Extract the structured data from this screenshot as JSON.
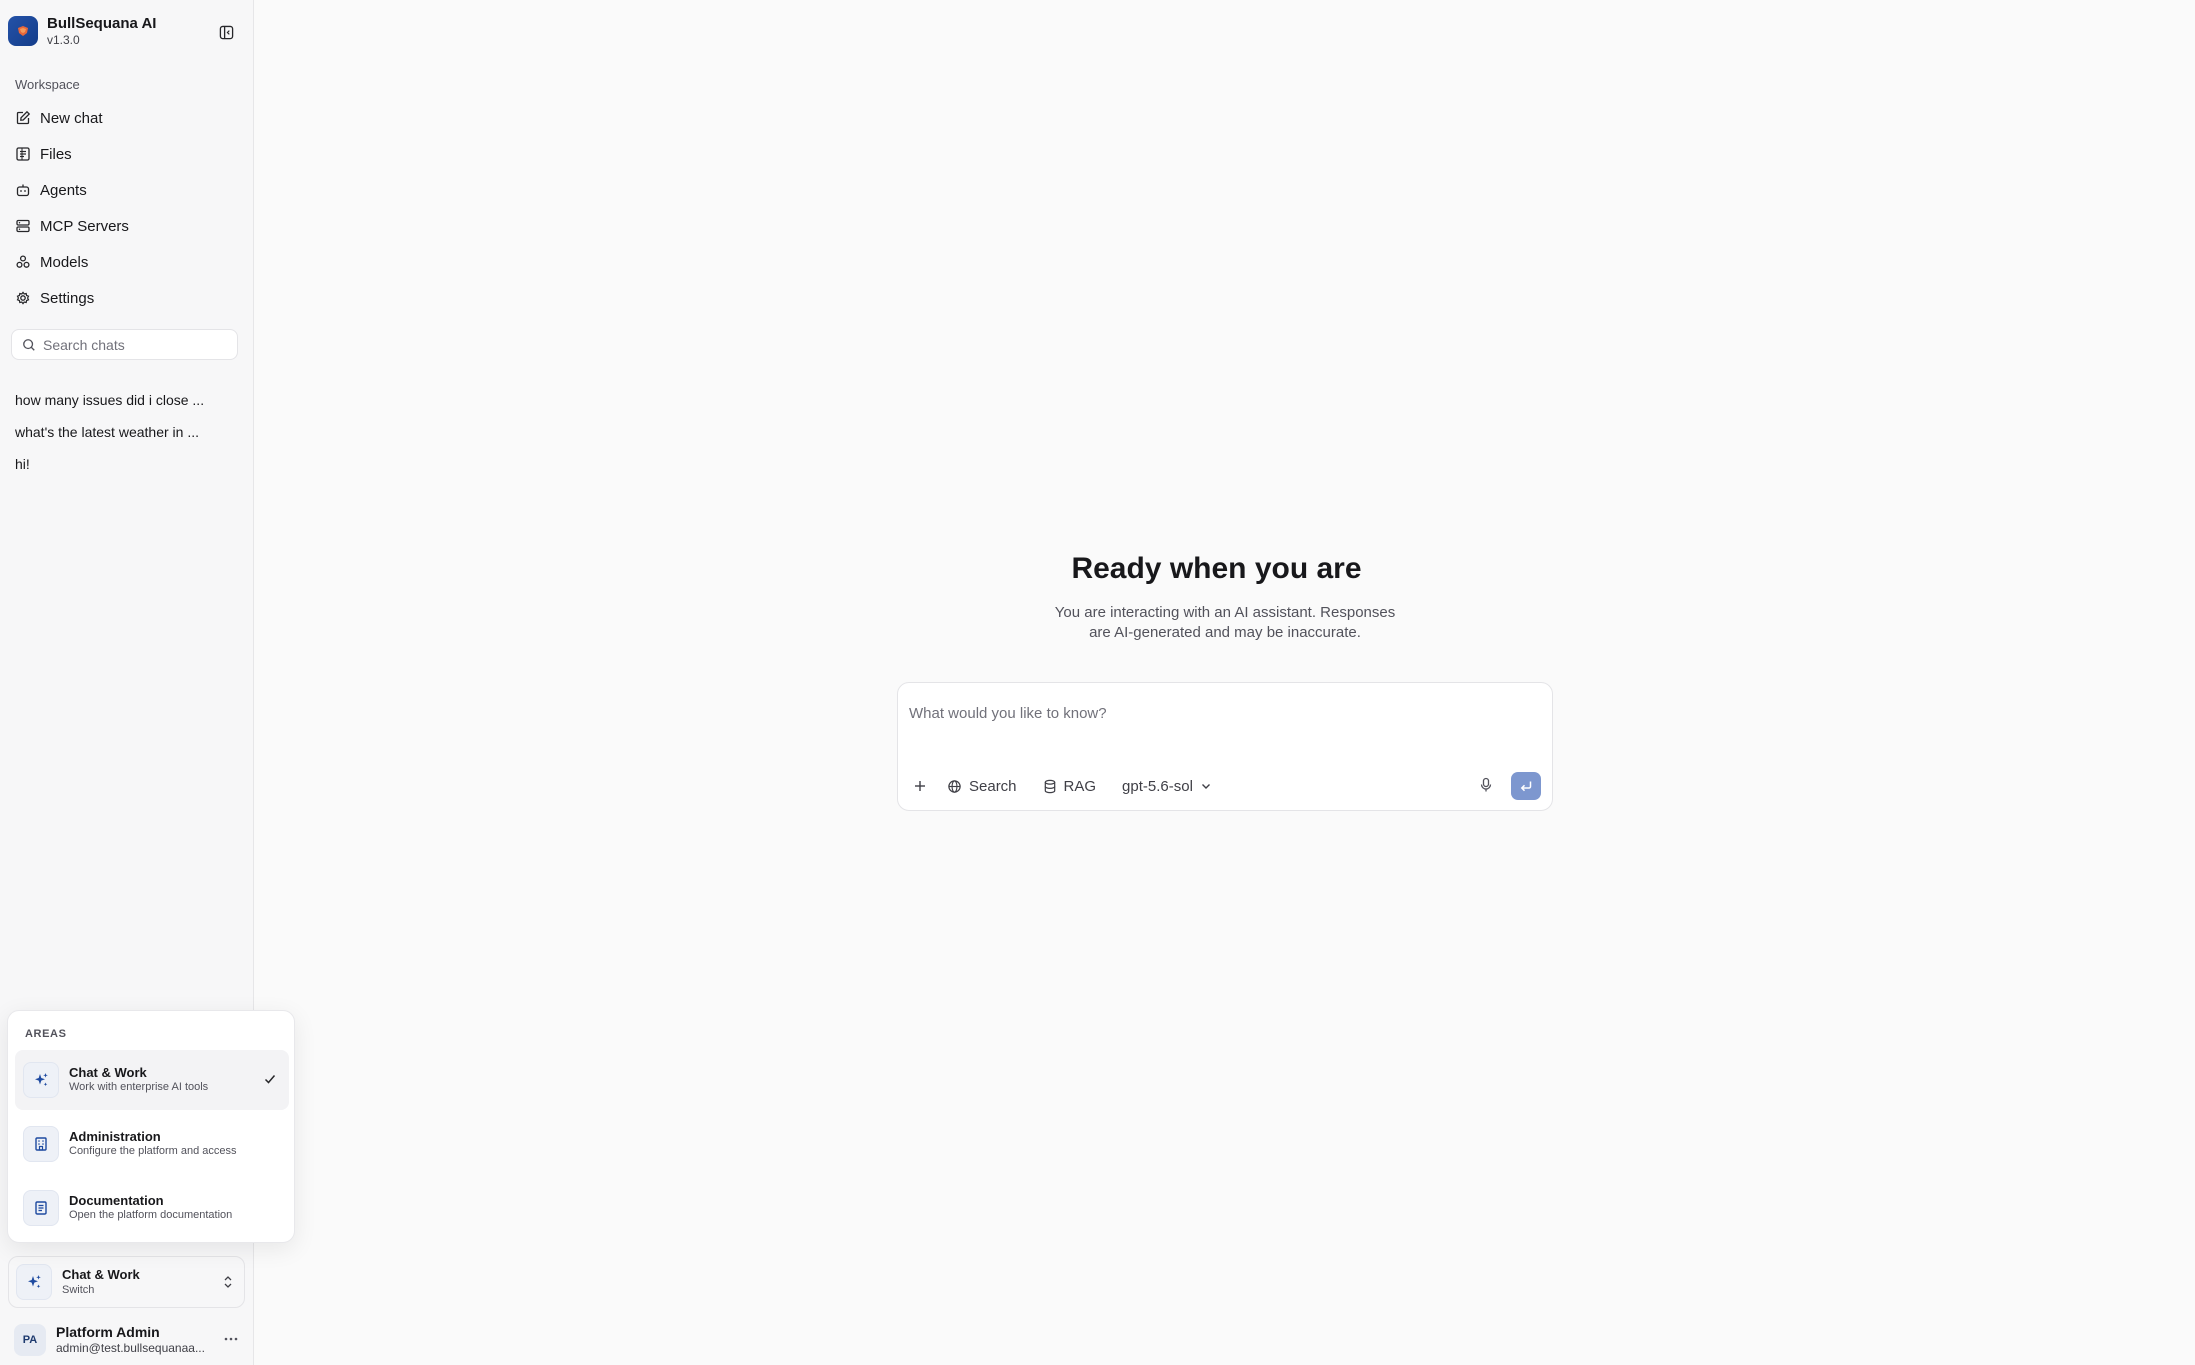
{
  "brand": {
    "name": "BullSequana AI",
    "version": "v1.3.0"
  },
  "sidebar": {
    "section_label": "Workspace",
    "items": [
      {
        "label": "New chat",
        "icon": "edit-icon"
      },
      {
        "label": "Files",
        "icon": "files-icon"
      },
      {
        "label": "Agents",
        "icon": "bot-icon"
      },
      {
        "label": "MCP Servers",
        "icon": "server-icon"
      },
      {
        "label": "Models",
        "icon": "models-icon"
      },
      {
        "label": "Settings",
        "icon": "gear-icon"
      }
    ],
    "search": {
      "placeholder": "Search chats",
      "value": ""
    },
    "chats": [
      "how many issues did i close ...",
      "what's the latest weather in ...",
      "hi!"
    ]
  },
  "areas_menu": {
    "label": "AREAS",
    "options": [
      {
        "title": "Chat & Work",
        "subtitle": "Work with enterprise AI tools",
        "icon": "sparkles-icon",
        "selected": true
      },
      {
        "title": "Administration",
        "subtitle": "Configure the platform and access",
        "icon": "building-icon",
        "selected": false
      },
      {
        "title": "Documentation",
        "subtitle": "Open the platform documentation",
        "icon": "document-icon",
        "selected": false
      }
    ]
  },
  "area_switcher": {
    "title": "Chat & Work",
    "subtitle": "Switch"
  },
  "user": {
    "initials": "PA",
    "name": "Platform Admin",
    "email": "admin@test.bullsequanaa..."
  },
  "main": {
    "title": "Ready when you are",
    "subtitle": "You are interacting with an AI assistant. Responses are AI-generated and may be inaccurate.",
    "composer": {
      "placeholder": "What would you like to know?",
      "value": "",
      "search_label": "Search",
      "rag_label": "RAG",
      "model": "gpt-5.6-sol"
    }
  },
  "colors": {
    "accent": "#1e4aa0",
    "send_button": "#7d97cf",
    "sidebar_bg": "#f7f7f8"
  }
}
